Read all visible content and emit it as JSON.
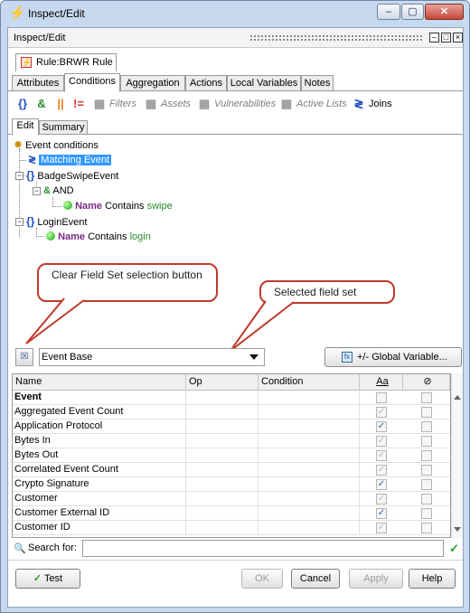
{
  "window": {
    "title": "Inspect/Edit",
    "minimize": "–",
    "maximize": "▢",
    "close": "✕"
  },
  "panel": {
    "title": "Inspect/Edit"
  },
  "rule_tab": {
    "label": "Rule:BRWR Rule"
  },
  "tabs": [
    "Attributes",
    "Conditions",
    "Aggregation",
    "Actions",
    "Local Variables",
    "Notes"
  ],
  "active_tab": "Conditions",
  "toolbar": {
    "filters": "Filters",
    "assets": "Assets",
    "vulnerabilities": "Vulnerabilities",
    "active_lists": "Active Lists",
    "joins": "Joins"
  },
  "subtabs": [
    "Edit",
    "Summary"
  ],
  "tree": {
    "root": "Event conditions",
    "matching": "Matching Event",
    "badge_event": "BadgeSwipeEvent",
    "and_op": "AND",
    "badge_cond": {
      "field": "Name",
      "op": "Contains",
      "value": "swipe"
    },
    "login_event": "LoginEvent",
    "login_cond": {
      "field": "Name",
      "op": "Contains",
      "value": "login"
    }
  },
  "callouts": {
    "clear": "Clear Field Set selection button",
    "selected": "Selected field set"
  },
  "fieldset": {
    "value": "Event Base"
  },
  "global_var_button": "+/- Global Variable...",
  "grid": {
    "headers": [
      "Name",
      "Op",
      "Condition",
      "Aa",
      "⊘"
    ],
    "rows": [
      {
        "name": "Event",
        "bold": true,
        "aa": false,
        "aa_dim": false
      },
      {
        "name": "Aggregated Event Count",
        "bold": false,
        "aa": true,
        "aa_dim": true
      },
      {
        "name": "Application Protocol",
        "bold": false,
        "aa": true,
        "aa_dim": false
      },
      {
        "name": "Bytes In",
        "bold": false,
        "aa": true,
        "aa_dim": true
      },
      {
        "name": "Bytes Out",
        "bold": false,
        "aa": true,
        "aa_dim": true
      },
      {
        "name": "Correlated Event Count",
        "bold": false,
        "aa": true,
        "aa_dim": true
      },
      {
        "name": "Crypto Signature",
        "bold": false,
        "aa": true,
        "aa_dim": false
      },
      {
        "name": "Customer",
        "bold": false,
        "aa": true,
        "aa_dim": true
      },
      {
        "name": "Customer External ID",
        "bold": false,
        "aa": true,
        "aa_dim": false
      },
      {
        "name": "Customer ID",
        "bold": false,
        "aa": true,
        "aa_dim": true
      }
    ]
  },
  "search": {
    "label": "Search for:",
    "value": ""
  },
  "buttons": {
    "test": "Test",
    "ok": "OK",
    "cancel": "Cancel",
    "apply": "Apply",
    "help": "Help"
  }
}
